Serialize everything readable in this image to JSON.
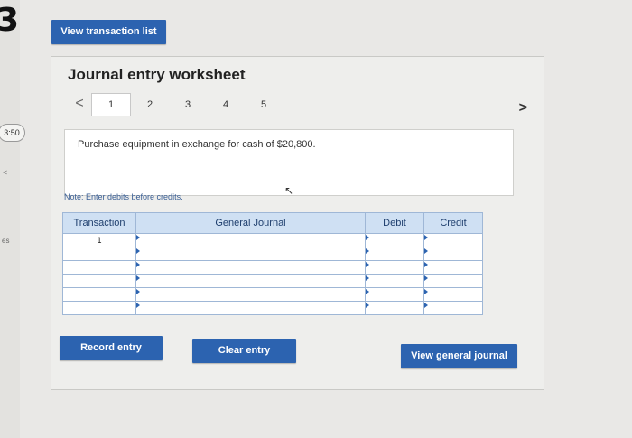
{
  "page_fragment": {
    "number": "3",
    "timer": "3:50",
    "side_text": "es",
    "side_mark": "<"
  },
  "view_transaction_list_label": "View transaction list",
  "worksheet": {
    "title": "Journal entry worksheet",
    "pager": {
      "prev": "<",
      "pages": [
        "1",
        "2",
        "3",
        "4",
        "5"
      ],
      "active_page": "1",
      "next": ">"
    },
    "description": "Purchase equipment in exchange for cash of $20,800.",
    "note": "Note: Enter debits before credits.",
    "table": {
      "headers": [
        "Transaction",
        "General Journal",
        "Debit",
        "Credit"
      ],
      "rows": [
        {
          "transaction": "1",
          "account": "",
          "debit": "",
          "credit": ""
        },
        {
          "transaction": "",
          "account": "",
          "debit": "",
          "credit": ""
        },
        {
          "transaction": "",
          "account": "",
          "debit": "",
          "credit": ""
        },
        {
          "transaction": "",
          "account": "",
          "debit": "",
          "credit": ""
        },
        {
          "transaction": "",
          "account": "",
          "debit": "",
          "credit": ""
        },
        {
          "transaction": "",
          "account": "",
          "debit": "",
          "credit": ""
        }
      ]
    },
    "buttons": {
      "record": "Record entry",
      "clear": "Clear entry",
      "view_general_journal": "View general journal"
    }
  },
  "colors": {
    "accent": "#2c63b0",
    "header_bg": "#cfe0f3",
    "note": "#3a5f96"
  }
}
